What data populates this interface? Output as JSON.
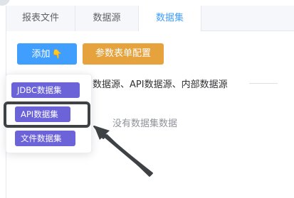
{
  "tabs": [
    {
      "label": "报表文件"
    },
    {
      "label": "数据源"
    },
    {
      "label": "数据集"
    }
  ],
  "toolbar": {
    "add_label": "添加",
    "add_icon": "pointing-hand-icon",
    "config_label": "参数表单配置"
  },
  "description": "数据源、API数据源、内部数据源",
  "empty_text": "没有数据集数据",
  "dropdown": {
    "items": [
      {
        "label": "JDBC数据集"
      },
      {
        "label": "API数据集"
      },
      {
        "label": "文件数据集"
      }
    ]
  },
  "colors": {
    "primary": "#409eff",
    "warning": "#e6a23c",
    "dropdown_item": "#6c63d9",
    "annotation": "#3f4245"
  }
}
